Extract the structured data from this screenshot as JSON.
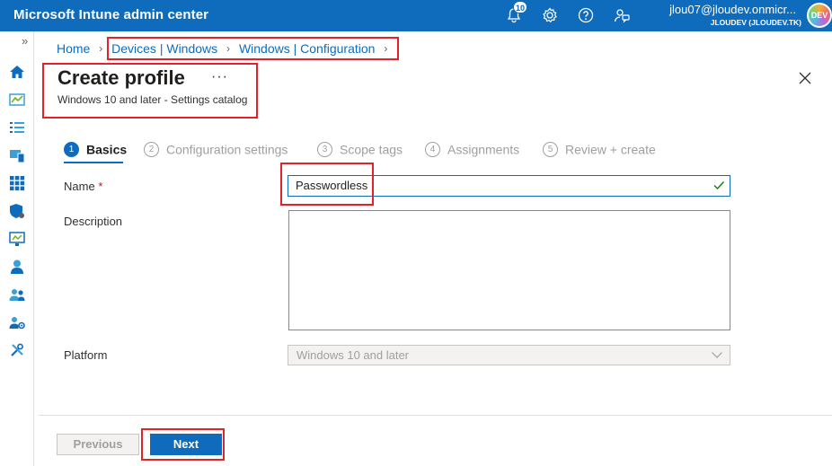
{
  "app": {
    "title": "Microsoft Intune admin center",
    "notification_count": "10",
    "user_email": "jlou07@jloudev.onmicr...",
    "user_tenant": "JLOUDEV (JLOUDEV.TK)",
    "avatar_initials": "DEV"
  },
  "rail": {
    "expand_glyph": "»",
    "icons": [
      "home-icon",
      "dashboard-icon",
      "all-services-icon",
      "devices-icon",
      "apps-icon",
      "endpoint-security-icon",
      "reports-icon",
      "users-icon",
      "groups-icon",
      "tenant-admin-icon",
      "troubleshooting-icon"
    ]
  },
  "breadcrumb": {
    "items": [
      "Home",
      "Devices | Windows",
      "Windows | Configuration"
    ]
  },
  "header": {
    "title": "Create profile",
    "more": "···",
    "subtitle": "Windows 10 and later - Settings catalog"
  },
  "steps": [
    {
      "num": "1",
      "label": "Basics"
    },
    {
      "num": "2",
      "label": "Configuration settings"
    },
    {
      "num": "3",
      "label": "Scope tags"
    },
    {
      "num": "4",
      "label": "Assignments"
    },
    {
      "num": "5",
      "label": "Review + create"
    }
  ],
  "form": {
    "name_label": "Name",
    "required_marker": "*",
    "name_value": "Passwordless",
    "description_label": "Description",
    "description_value": "",
    "platform_label": "Platform",
    "platform_value": "Windows 10 and later"
  },
  "footer": {
    "previous_label": "Previous",
    "next_label": "Next"
  },
  "colors": {
    "brand": "#0f6cbd",
    "annotation": "#e3212a",
    "valid": "#107c10"
  }
}
